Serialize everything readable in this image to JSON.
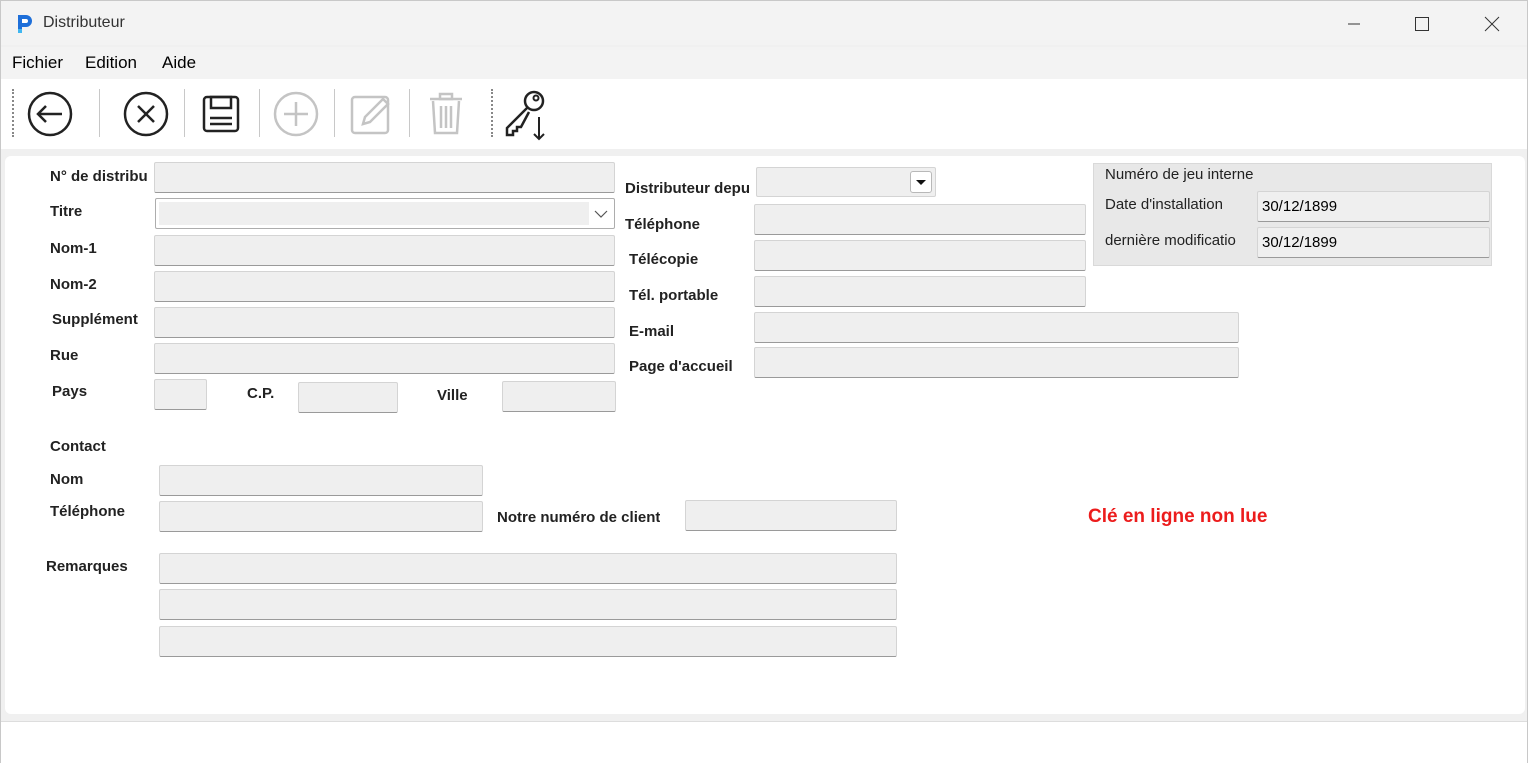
{
  "window": {
    "title": "Distributeur"
  },
  "menu": [
    "Fichier",
    "Edition",
    "Aide"
  ],
  "toolbar": {
    "buttons": [
      "back-arrow-icon",
      "cancel-circle-x-icon",
      "save-floppy-icon",
      "add-plus-icon",
      "edit-pencil-icon",
      "delete-trash-icon",
      "key-download-icon"
    ]
  },
  "form": {
    "labels": {
      "distributor_no": "N° de distribu",
      "title": "Titre",
      "name1": "Nom-1",
      "name2": "Nom-2",
      "supplement": "Supplément",
      "street": "Rue",
      "country": "Pays",
      "zip": "C.P.",
      "city": "Ville",
      "contact": "Contact",
      "contact_name": "Nom",
      "contact_phone": "Téléphone",
      "customer_no": "Notre numéro de client",
      "remarks": "Remarques",
      "distributor_since": "Distributeur depu",
      "phone": "Téléphone",
      "fax": "Télécopie",
      "mobile": "Tél. portable",
      "email": "E-mail",
      "homepage": "Page d'accueil"
    },
    "values": {
      "distributor_no": "",
      "title": "",
      "name1": "",
      "name2": "",
      "supplement": "",
      "street": "",
      "country": "",
      "zip": "",
      "city": "",
      "contact_name": "",
      "contact_phone": "",
      "customer_no": "",
      "remark1": "",
      "remark2": "",
      "remark3": "",
      "distributor_since": "",
      "phone": "",
      "fax": "",
      "mobile": "",
      "email": "",
      "homepage": ""
    }
  },
  "info_group": {
    "heading": "Numéro de jeu interne",
    "install_label": "Date d'installation",
    "install_value": "30/12/1899",
    "modified_label": "dernière modificatio",
    "modified_value": "30/12/1899"
  },
  "status_message": "Clé en ligne non lue",
  "colors": {
    "status_message": "#ec1c1c",
    "field_bg": "#efefef"
  }
}
